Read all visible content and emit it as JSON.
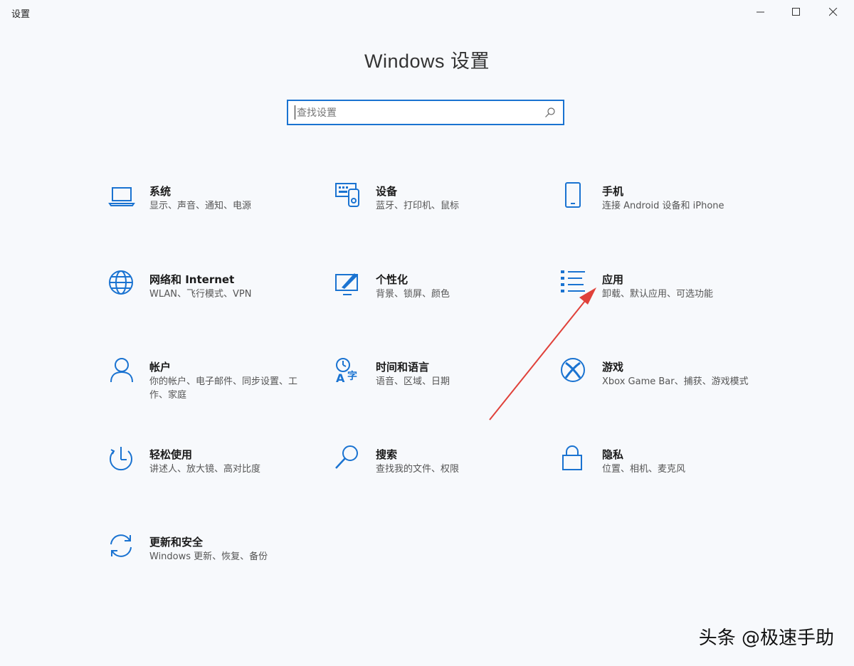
{
  "window": {
    "title": "设置",
    "controls": {
      "minimize": "—",
      "maximize": "☐",
      "close": "✕"
    }
  },
  "heading": "Windows 设置",
  "search": {
    "placeholder": "查找设置",
    "value": "",
    "icon": "search-icon"
  },
  "tiles": [
    {
      "name": "系统",
      "desc": "显示、声音、通知、电源",
      "icon": "laptop-icon"
    },
    {
      "name": "设备",
      "desc": "蓝牙、打印机、鼠标",
      "icon": "devices-icon"
    },
    {
      "name": "手机",
      "desc": "连接 Android 设备和 iPhone",
      "icon": "phone-icon"
    },
    {
      "name": "网络和 Internet",
      "desc": "WLAN、飞行模式、VPN",
      "icon": "globe-icon"
    },
    {
      "name": "个性化",
      "desc": "背景、锁屏、颜色",
      "icon": "personalization-icon"
    },
    {
      "name": "应用",
      "desc": "卸载、默认应用、可选功能",
      "icon": "apps-list-icon"
    },
    {
      "name": "帐户",
      "desc": "你的帐户、电子邮件、同步设置、工作、家庭",
      "icon": "person-icon"
    },
    {
      "name": "时间和语言",
      "desc": "语音、区域、日期",
      "icon": "time-language-icon"
    },
    {
      "name": "游戏",
      "desc": "Xbox Game Bar、捕获、游戏模式",
      "icon": "xbox-icon"
    },
    {
      "name": "轻松使用",
      "desc": "讲述人、放大镜、高对比度",
      "icon": "ease-of-access-icon"
    },
    {
      "name": "搜索",
      "desc": "查找我的文件、权限",
      "icon": "search-icon"
    },
    {
      "name": "隐私",
      "desc": "位置、相机、麦克风",
      "icon": "lock-icon"
    },
    {
      "name": "更新和安全",
      "desc": "Windows 更新、恢复、备份",
      "icon": "sync-icon"
    }
  ],
  "watermark": "头条 @极速手助",
  "colors": {
    "accent": "#1a73d1",
    "arrow": "#e0413a"
  }
}
